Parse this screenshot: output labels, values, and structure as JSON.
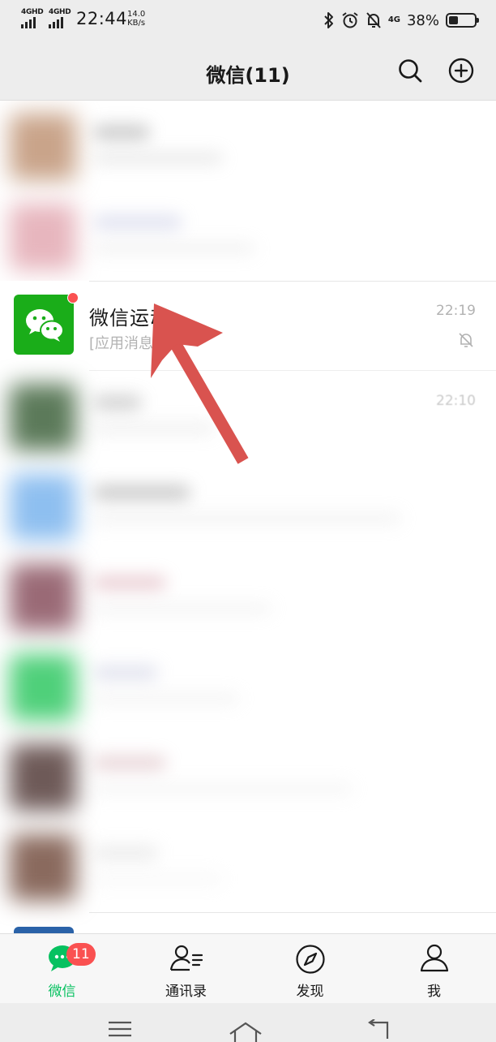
{
  "status_bar": {
    "sim1": "4GHD",
    "sim2": "4GHD",
    "time": "22:44",
    "net_speed_value": "14.0",
    "net_speed_unit": "KB/s",
    "net_type": "4G",
    "battery_percent": "38%",
    "battery_level": 0.38
  },
  "title_bar": {
    "title": "微信(11)",
    "search_icon": "search-icon",
    "add_icon": "add-circle-icon"
  },
  "chat_list": {
    "featured": {
      "name": "微信运动",
      "preview": "[应用消息",
      "time": "22:19",
      "muted": true,
      "unread_dot": true,
      "icon": "wechat-bubbles-icon",
      "avatar_color": "#1aad19"
    },
    "blurred_time": "22:10",
    "blurred_rows": 8
  },
  "annotation": {
    "arrow_color": "#d9534f"
  },
  "tab_bar": {
    "tabs": [
      {
        "label": "微信",
        "icon": "chat-bubble-icon",
        "active": true,
        "badge": "11"
      },
      {
        "label": "通讯录",
        "icon": "contacts-icon",
        "active": false
      },
      {
        "label": "发现",
        "icon": "compass-icon",
        "active": false
      },
      {
        "label": "我",
        "icon": "person-icon",
        "active": false
      }
    ],
    "active_color": "#07c160"
  },
  "system_nav": {
    "menu_icon": "menu-icon",
    "home_icon": "home-icon",
    "back_icon": "back-icon"
  }
}
